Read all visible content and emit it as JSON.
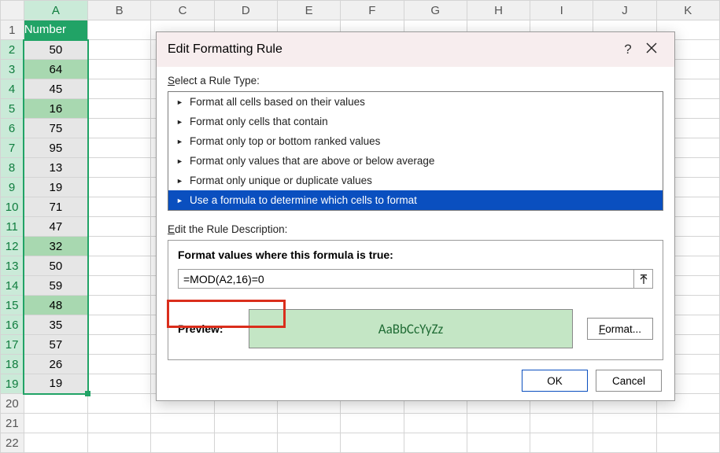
{
  "sheet": {
    "columns": [
      "A",
      "B",
      "C",
      "D",
      "E",
      "F",
      "G",
      "H",
      "I",
      "J",
      "K"
    ],
    "rows": [
      1,
      2,
      3,
      4,
      5,
      6,
      7,
      8,
      9,
      10,
      11,
      12,
      13,
      14,
      15,
      16,
      17,
      18,
      19,
      20,
      21,
      22
    ],
    "header_label": "Number",
    "data": [
      {
        "v": 50,
        "hl": false
      },
      {
        "v": 64,
        "hl": true
      },
      {
        "v": 45,
        "hl": false
      },
      {
        "v": 16,
        "hl": true
      },
      {
        "v": 75,
        "hl": false
      },
      {
        "v": 95,
        "hl": false
      },
      {
        "v": 13,
        "hl": false
      },
      {
        "v": 19,
        "hl": false
      },
      {
        "v": 71,
        "hl": false
      },
      {
        "v": 47,
        "hl": false
      },
      {
        "v": 32,
        "hl": true
      },
      {
        "v": 50,
        "hl": false
      },
      {
        "v": 59,
        "hl": false
      },
      {
        "v": 48,
        "hl": true
      },
      {
        "v": 35,
        "hl": false
      },
      {
        "v": 57,
        "hl": false
      },
      {
        "v": 26,
        "hl": false
      },
      {
        "v": 19,
        "hl": false
      }
    ]
  },
  "dialog": {
    "title": "Edit Formatting Rule",
    "help_label": "?",
    "close_label": "X",
    "rule_type_label": "Select a Rule Type:",
    "rule_types": [
      "Format all cells based on their values",
      "Format only cells that contain",
      "Format only top or bottom ranked values",
      "Format only values that are above or below average",
      "Format only unique or duplicate values",
      "Use a formula to determine which cells to format"
    ],
    "selected_rule_index": 5,
    "desc_label": "Edit the Rule Description:",
    "formula_heading": "Format values where this formula is true:",
    "formula_value": "=MOD(A2,16)=0",
    "preview_label": "Preview:",
    "preview_text": "AaBbCcYyZz",
    "format_button": "Format...",
    "ok_button": "OK",
    "cancel_button": "Cancel"
  }
}
